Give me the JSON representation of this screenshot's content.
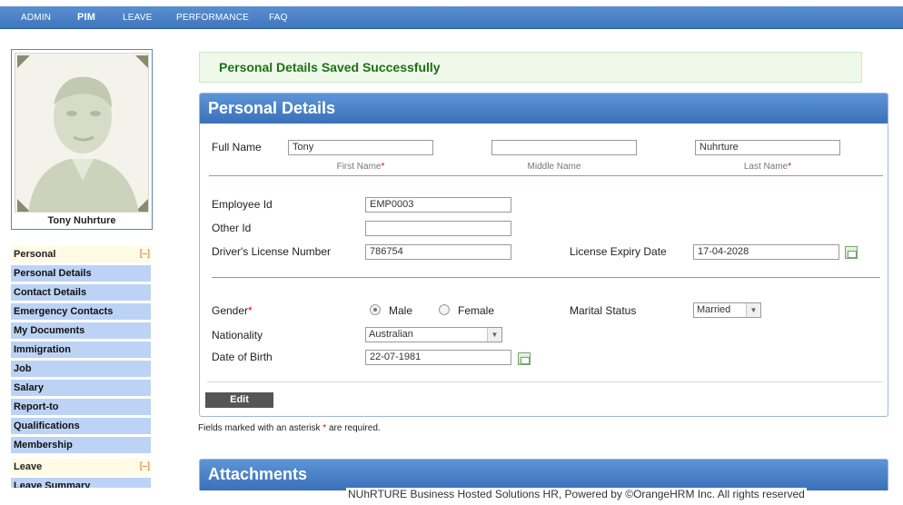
{
  "nav": {
    "items": [
      {
        "label": "ADMIN"
      },
      {
        "label": "PIM"
      },
      {
        "label": "LEAVE"
      },
      {
        "label": "PERFORMANCE"
      },
      {
        "label": "FAQ"
      }
    ],
    "active": "PIM"
  },
  "profile": {
    "name": "Tony Nuhrture"
  },
  "sidebar": {
    "personal": {
      "heading": "Personal",
      "toggle": "[–]",
      "items": [
        "Personal Details",
        "Contact Details",
        "Emergency Contacts",
        "My Documents",
        "Immigration",
        "Job",
        "Salary",
        "Report-to",
        "Qualifications",
        "Membership"
      ]
    },
    "leave": {
      "heading": "Leave",
      "toggle": "[–]",
      "items": [
        "Leave Summary"
      ]
    }
  },
  "message": "Personal Details Saved Successfully",
  "panel": {
    "title": "Personal Details",
    "full_name_label": "Full Name",
    "first_name": "Tony",
    "middle_name": "",
    "last_name": "Nuhrture",
    "first_name_caption": "First Name",
    "middle_name_caption": "Middle Name",
    "last_name_caption": "Last Name",
    "required_mark": "*",
    "employee_id_label": "Employee Id",
    "employee_id": "EMP0003",
    "other_id_label": "Other Id",
    "other_id": "",
    "license_label": "Driver's License Number",
    "license": "786754",
    "license_expiry_label": "License Expiry Date",
    "license_expiry": "17-04-2028",
    "gender_label": "Gender",
    "gender_options": [
      "Male",
      "Female"
    ],
    "gender_selected": "Male",
    "marital_label": "Marital Status",
    "marital_status": "Married",
    "nationality_label": "Nationality",
    "nationality": "Australian",
    "dob_label": "Date of Birth",
    "dob": "22-07-1981",
    "edit_label": "Edit"
  },
  "note": {
    "before": "Fields marked with an asterisk ",
    "mark": "*",
    "after": " are required."
  },
  "attachments_title": "Attachments",
  "footer": "NUhRTURE Business Hosted Solutions HR, Powered by ©OrangeHRM Inc. All rights reserved",
  "colors": {
    "nav": "#3f76bd",
    "panel_header": "#4a82c8",
    "menu_item": "#bcd3f5",
    "success_text": "#1f6f16",
    "required": "#cc1111"
  }
}
